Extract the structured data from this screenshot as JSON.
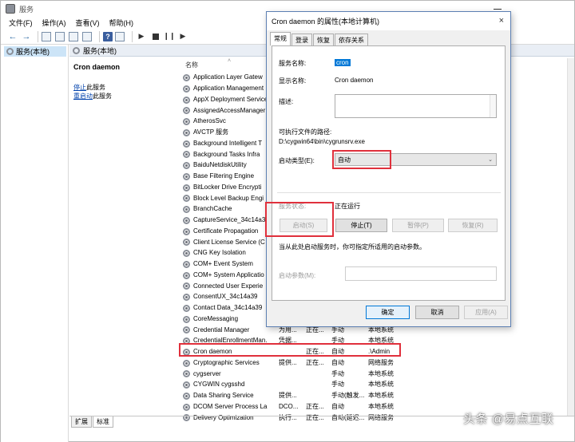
{
  "window": {
    "title": "服务",
    "menu": [
      "文件(F)",
      "操作(A)",
      "查看(V)",
      "帮助(H)"
    ]
  },
  "tree": {
    "root": "服务(本地)"
  },
  "panel": {
    "header": "服务(本地)",
    "selected_service": "Cron daemon",
    "stop_link": "停止",
    "stop_suffix": "此服务",
    "restart_link": "重启动",
    "restart_suffix": "此服务"
  },
  "columns": {
    "name": "名称"
  },
  "services": [
    {
      "name": "Application Layer Gatew",
      "desc": "",
      "status": "",
      "startup": "",
      "logon": ""
    },
    {
      "name": "Application Management",
      "desc": "",
      "status": "",
      "startup": "",
      "logon": ""
    },
    {
      "name": "AppX Deployment Service",
      "desc": "",
      "status": "",
      "startup": "",
      "logon": ""
    },
    {
      "name": "AssignedAccessManager",
      "desc": "",
      "status": "",
      "startup": "",
      "logon": ""
    },
    {
      "name": "AtherosSvc",
      "desc": "",
      "status": "",
      "startup": "",
      "logon": ""
    },
    {
      "name": "AVCTP 服务",
      "desc": "",
      "status": "",
      "startup": "",
      "logon": ""
    },
    {
      "name": "Background Intelligent T",
      "desc": "",
      "status": "",
      "startup": "",
      "logon": ""
    },
    {
      "name": "Background Tasks Infra",
      "desc": "",
      "status": "",
      "startup": "",
      "logon": ""
    },
    {
      "name": "BaiduNetdiskUtility",
      "desc": "",
      "status": "",
      "startup": "",
      "logon": ""
    },
    {
      "name": "Base Filtering Engine",
      "desc": "",
      "status": "",
      "startup": "",
      "logon": ""
    },
    {
      "name": "BitLocker Drive Encrypti",
      "desc": "",
      "status": "",
      "startup": "",
      "logon": ""
    },
    {
      "name": "Block Level Backup Engi",
      "desc": "",
      "status": "",
      "startup": "",
      "logon": ""
    },
    {
      "name": "BranchCache",
      "desc": "",
      "status": "",
      "startup": "",
      "logon": ""
    },
    {
      "name": "CaptureService_34c14a3",
      "desc": "",
      "status": "",
      "startup": "",
      "logon": ""
    },
    {
      "name": "Certificate Propagation",
      "desc": "",
      "status": "",
      "startup": "",
      "logon": ""
    },
    {
      "name": "Client License Service (C",
      "desc": "",
      "status": "",
      "startup": "",
      "logon": ""
    },
    {
      "name": "CNG Key Isolation",
      "desc": "",
      "status": "",
      "startup": "",
      "logon": ""
    },
    {
      "name": "COM+ Event System",
      "desc": "",
      "status": "",
      "startup": "",
      "logon": ""
    },
    {
      "name": "COM+ System Applicatio",
      "desc": "",
      "status": "",
      "startup": "",
      "logon": ""
    },
    {
      "name": "Connected User Experie",
      "desc": "",
      "status": "",
      "startup": "",
      "logon": ""
    },
    {
      "name": "ConsentUX_34c14a39",
      "desc": "",
      "status": "",
      "startup": "",
      "logon": ""
    },
    {
      "name": "Contact Data_34c14a39",
      "desc": "",
      "status": "",
      "startup": "",
      "logon": ""
    },
    {
      "name": "CoreMessaging",
      "desc": "",
      "status": "",
      "startup": "",
      "logon": ""
    },
    {
      "name": "Credential Manager",
      "desc": "为用...",
      "status": "正在...",
      "startup": "手动",
      "logon": "本地系统"
    },
    {
      "name": "CredentialEnrollmentMan...",
      "desc": "凭据...",
      "status": "",
      "startup": "手动",
      "logon": "本地系统"
    },
    {
      "name": "Cron daemon",
      "desc": "",
      "status": "正在...",
      "startup": "自动",
      "logon": ".\\Admin"
    },
    {
      "name": "Cryptographic Services",
      "desc": "提供...",
      "status": "正在...",
      "startup": "自动",
      "logon": "网络服务"
    },
    {
      "name": "cygserver",
      "desc": "",
      "status": "",
      "startup": "手动",
      "logon": "本地系统"
    },
    {
      "name": "CYGWIN cygsshd",
      "desc": "",
      "status": "",
      "startup": "手动",
      "logon": "本地系统"
    },
    {
      "name": "Data Sharing Service",
      "desc": "提供...",
      "status": "",
      "startup": "手动(触发...",
      "logon": "本地系统"
    },
    {
      "name": "DCOM Server Process La...",
      "desc": "DCO...",
      "status": "正在...",
      "startup": "自动",
      "logon": "本地系统"
    },
    {
      "name": "Delivery Optimization",
      "desc": "执行...",
      "status": "正在...",
      "startup": "自动(延迟...",
      "logon": "网络服务"
    }
  ],
  "bottom_tabs": [
    "扩展",
    "标准"
  ],
  "dialog": {
    "title": "Cron daemon 的属性(本地计算机)",
    "close": "×",
    "tabs": [
      "常规",
      "登录",
      "恢复",
      "依存关系"
    ],
    "service_name_label": "服务名称:",
    "service_name": "cron",
    "display_name_label": "显示名称:",
    "display_name": "Cron daemon",
    "description_label": "描述:",
    "exe_path_label": "可执行文件的路径:",
    "exe_path": "D:\\cygwin64\\bin\\cygrunsrv.exe",
    "startup_type_label": "启动类型(E):",
    "startup_type": "自动",
    "status_label": "服务状态:",
    "status": "正在运行",
    "btn_start": "启动(S)",
    "btn_stop": "停止(T)",
    "btn_pause": "暂停(P)",
    "btn_resume": "恢复(R)",
    "hint": "当从此处启动服务时，你可指定所适用的启动参数。",
    "param_label": "启动参数(M):",
    "btn_ok": "确定",
    "btn_cancel": "取消",
    "btn_apply": "应用(A)"
  },
  "watermark": "头条 @易点互联"
}
